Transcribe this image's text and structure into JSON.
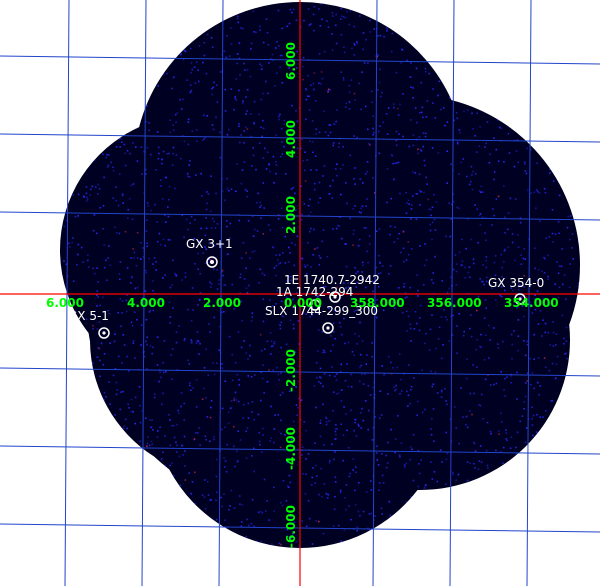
{
  "image": {
    "background": "#ffffff",
    "sky_color": "#000022",
    "count_color": "#2a2aff",
    "hot_count_color": "#cc2244",
    "grid_color": "#2244cc",
    "axis_color": "#ff0000",
    "label_color": "#00ff00",
    "source_color": "#ffffff"
  },
  "axes": {
    "longitude_ticks": [
      "6.000",
      "4.000",
      "2.000",
      "0.000",
      "358.000",
      "356.000",
      "354.000"
    ],
    "latitude_ticks": [
      "6.000",
      "4.000",
      "2.000",
      "-2.000",
      "-4.000",
      "-6.000"
    ]
  },
  "sources": [
    {
      "name": "GX 3+1"
    },
    {
      "name": "1E 1740.7-2942"
    },
    {
      "name": "1A 1742-294"
    },
    {
      "name": "SLX 1744-299_300"
    },
    {
      "name": "GX 354-0"
    },
    {
      "name": "GX 5-1"
    }
  ]
}
